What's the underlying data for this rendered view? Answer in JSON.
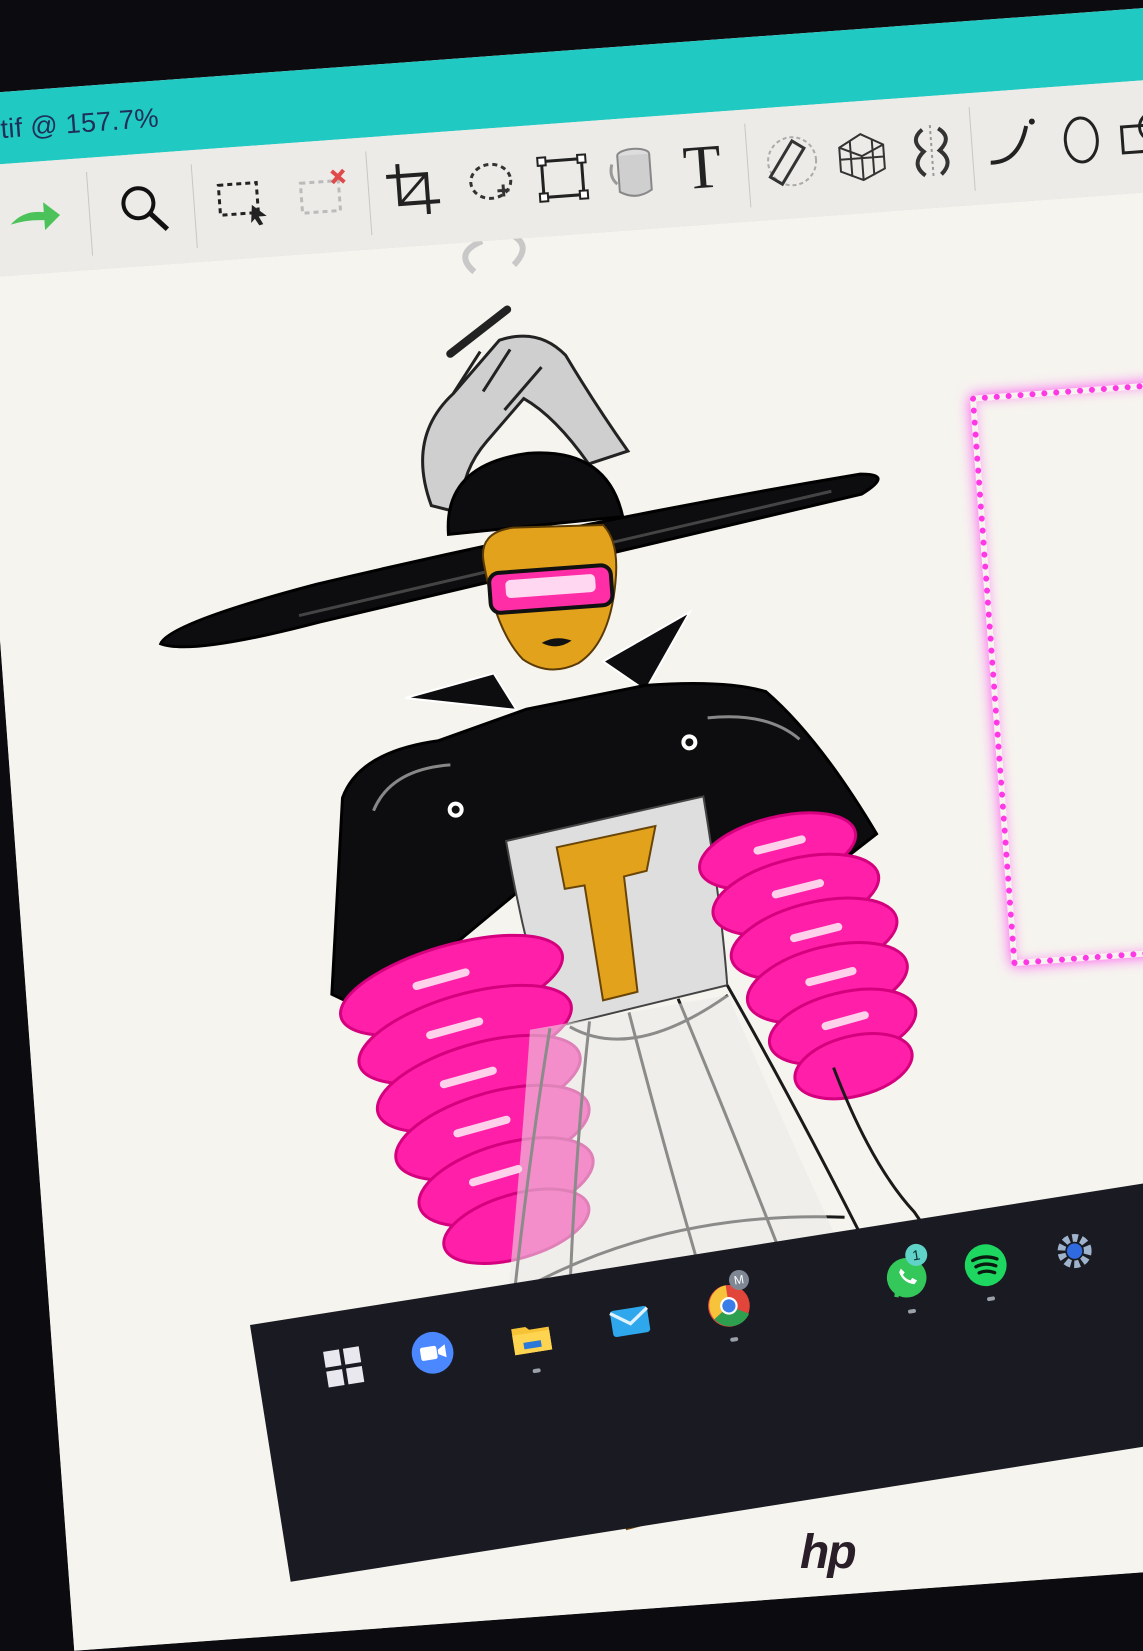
{
  "window": {
    "title": "tif @ 157.7%"
  },
  "toolbar": {
    "tools": [
      "redo-icon",
      "zoom-icon",
      "selection-icon",
      "clear-selection-icon",
      "crop-icon",
      "lasso-select-icon",
      "transform-icon",
      "fill-icon",
      "text-icon",
      "ruler-icon",
      "perspective-grid-icon",
      "symmetry-icon",
      "curve-icon",
      "ellipse-icon",
      "shape-icon"
    ],
    "text_tool_glyph": "T"
  },
  "taskbar": {
    "icons": [
      "windows-start-icon",
      "zoom-app-icon",
      "file-explorer-icon",
      "mail-icon",
      "chrome-icon",
      "whatsapp-icon",
      "spotify-icon",
      "settings-icon"
    ],
    "whatsapp_badge": "1",
    "chrome_badge": "M"
  },
  "monitor": {
    "brand": "hp"
  },
  "colors": {
    "titlebar": "#20c9c2",
    "neon": "#ff38e6",
    "pink_sleeves": "#ff1fa8",
    "gold_skin": "#e3a31d",
    "black_coat": "#111114"
  }
}
